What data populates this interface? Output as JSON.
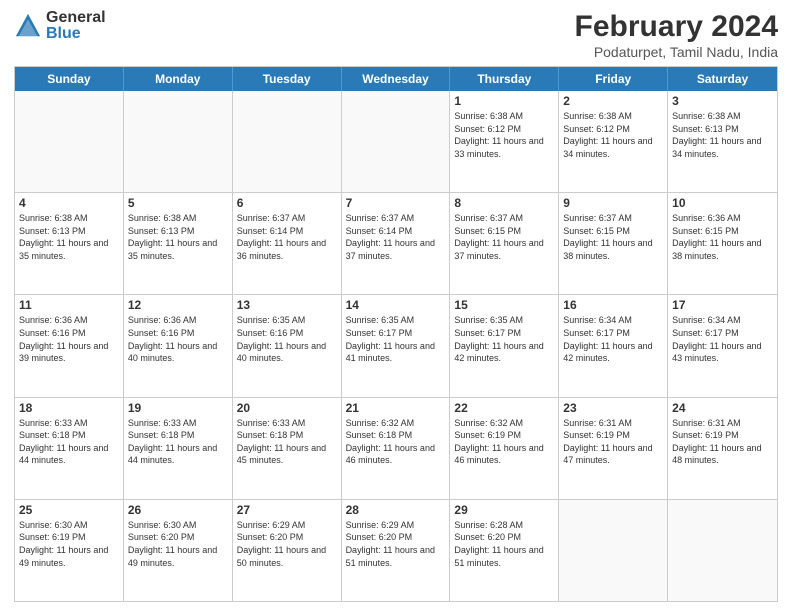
{
  "logo": {
    "general": "General",
    "blue": "Blue"
  },
  "header": {
    "title": "February 2024",
    "subtitle": "Podaturpet, Tamil Nadu, India"
  },
  "days": [
    "Sunday",
    "Monday",
    "Tuesday",
    "Wednesday",
    "Thursday",
    "Friday",
    "Saturday"
  ],
  "weeks": [
    [
      {
        "day": "",
        "info": ""
      },
      {
        "day": "",
        "info": ""
      },
      {
        "day": "",
        "info": ""
      },
      {
        "day": "",
        "info": ""
      },
      {
        "day": "1",
        "info": "Sunrise: 6:38 AM\nSunset: 6:12 PM\nDaylight: 11 hours and 33 minutes."
      },
      {
        "day": "2",
        "info": "Sunrise: 6:38 AM\nSunset: 6:12 PM\nDaylight: 11 hours and 34 minutes."
      },
      {
        "day": "3",
        "info": "Sunrise: 6:38 AM\nSunset: 6:13 PM\nDaylight: 11 hours and 34 minutes."
      }
    ],
    [
      {
        "day": "4",
        "info": "Sunrise: 6:38 AM\nSunset: 6:13 PM\nDaylight: 11 hours and 35 minutes."
      },
      {
        "day": "5",
        "info": "Sunrise: 6:38 AM\nSunset: 6:13 PM\nDaylight: 11 hours and 35 minutes."
      },
      {
        "day": "6",
        "info": "Sunrise: 6:37 AM\nSunset: 6:14 PM\nDaylight: 11 hours and 36 minutes."
      },
      {
        "day": "7",
        "info": "Sunrise: 6:37 AM\nSunset: 6:14 PM\nDaylight: 11 hours and 37 minutes."
      },
      {
        "day": "8",
        "info": "Sunrise: 6:37 AM\nSunset: 6:15 PM\nDaylight: 11 hours and 37 minutes."
      },
      {
        "day": "9",
        "info": "Sunrise: 6:37 AM\nSunset: 6:15 PM\nDaylight: 11 hours and 38 minutes."
      },
      {
        "day": "10",
        "info": "Sunrise: 6:36 AM\nSunset: 6:15 PM\nDaylight: 11 hours and 38 minutes."
      }
    ],
    [
      {
        "day": "11",
        "info": "Sunrise: 6:36 AM\nSunset: 6:16 PM\nDaylight: 11 hours and 39 minutes."
      },
      {
        "day": "12",
        "info": "Sunrise: 6:36 AM\nSunset: 6:16 PM\nDaylight: 11 hours and 40 minutes."
      },
      {
        "day": "13",
        "info": "Sunrise: 6:35 AM\nSunset: 6:16 PM\nDaylight: 11 hours and 40 minutes."
      },
      {
        "day": "14",
        "info": "Sunrise: 6:35 AM\nSunset: 6:17 PM\nDaylight: 11 hours and 41 minutes."
      },
      {
        "day": "15",
        "info": "Sunrise: 6:35 AM\nSunset: 6:17 PM\nDaylight: 11 hours and 42 minutes."
      },
      {
        "day": "16",
        "info": "Sunrise: 6:34 AM\nSunset: 6:17 PM\nDaylight: 11 hours and 42 minutes."
      },
      {
        "day": "17",
        "info": "Sunrise: 6:34 AM\nSunset: 6:17 PM\nDaylight: 11 hours and 43 minutes."
      }
    ],
    [
      {
        "day": "18",
        "info": "Sunrise: 6:33 AM\nSunset: 6:18 PM\nDaylight: 11 hours and 44 minutes."
      },
      {
        "day": "19",
        "info": "Sunrise: 6:33 AM\nSunset: 6:18 PM\nDaylight: 11 hours and 44 minutes."
      },
      {
        "day": "20",
        "info": "Sunrise: 6:33 AM\nSunset: 6:18 PM\nDaylight: 11 hours and 45 minutes."
      },
      {
        "day": "21",
        "info": "Sunrise: 6:32 AM\nSunset: 6:18 PM\nDaylight: 11 hours and 46 minutes."
      },
      {
        "day": "22",
        "info": "Sunrise: 6:32 AM\nSunset: 6:19 PM\nDaylight: 11 hours and 46 minutes."
      },
      {
        "day": "23",
        "info": "Sunrise: 6:31 AM\nSunset: 6:19 PM\nDaylight: 11 hours and 47 minutes."
      },
      {
        "day": "24",
        "info": "Sunrise: 6:31 AM\nSunset: 6:19 PM\nDaylight: 11 hours and 48 minutes."
      }
    ],
    [
      {
        "day": "25",
        "info": "Sunrise: 6:30 AM\nSunset: 6:19 PM\nDaylight: 11 hours and 49 minutes."
      },
      {
        "day": "26",
        "info": "Sunrise: 6:30 AM\nSunset: 6:20 PM\nDaylight: 11 hours and 49 minutes."
      },
      {
        "day": "27",
        "info": "Sunrise: 6:29 AM\nSunset: 6:20 PM\nDaylight: 11 hours and 50 minutes."
      },
      {
        "day": "28",
        "info": "Sunrise: 6:29 AM\nSunset: 6:20 PM\nDaylight: 11 hours and 51 minutes."
      },
      {
        "day": "29",
        "info": "Sunrise: 6:28 AM\nSunset: 6:20 PM\nDaylight: 11 hours and 51 minutes."
      },
      {
        "day": "",
        "info": ""
      },
      {
        "day": "",
        "info": ""
      }
    ]
  ]
}
